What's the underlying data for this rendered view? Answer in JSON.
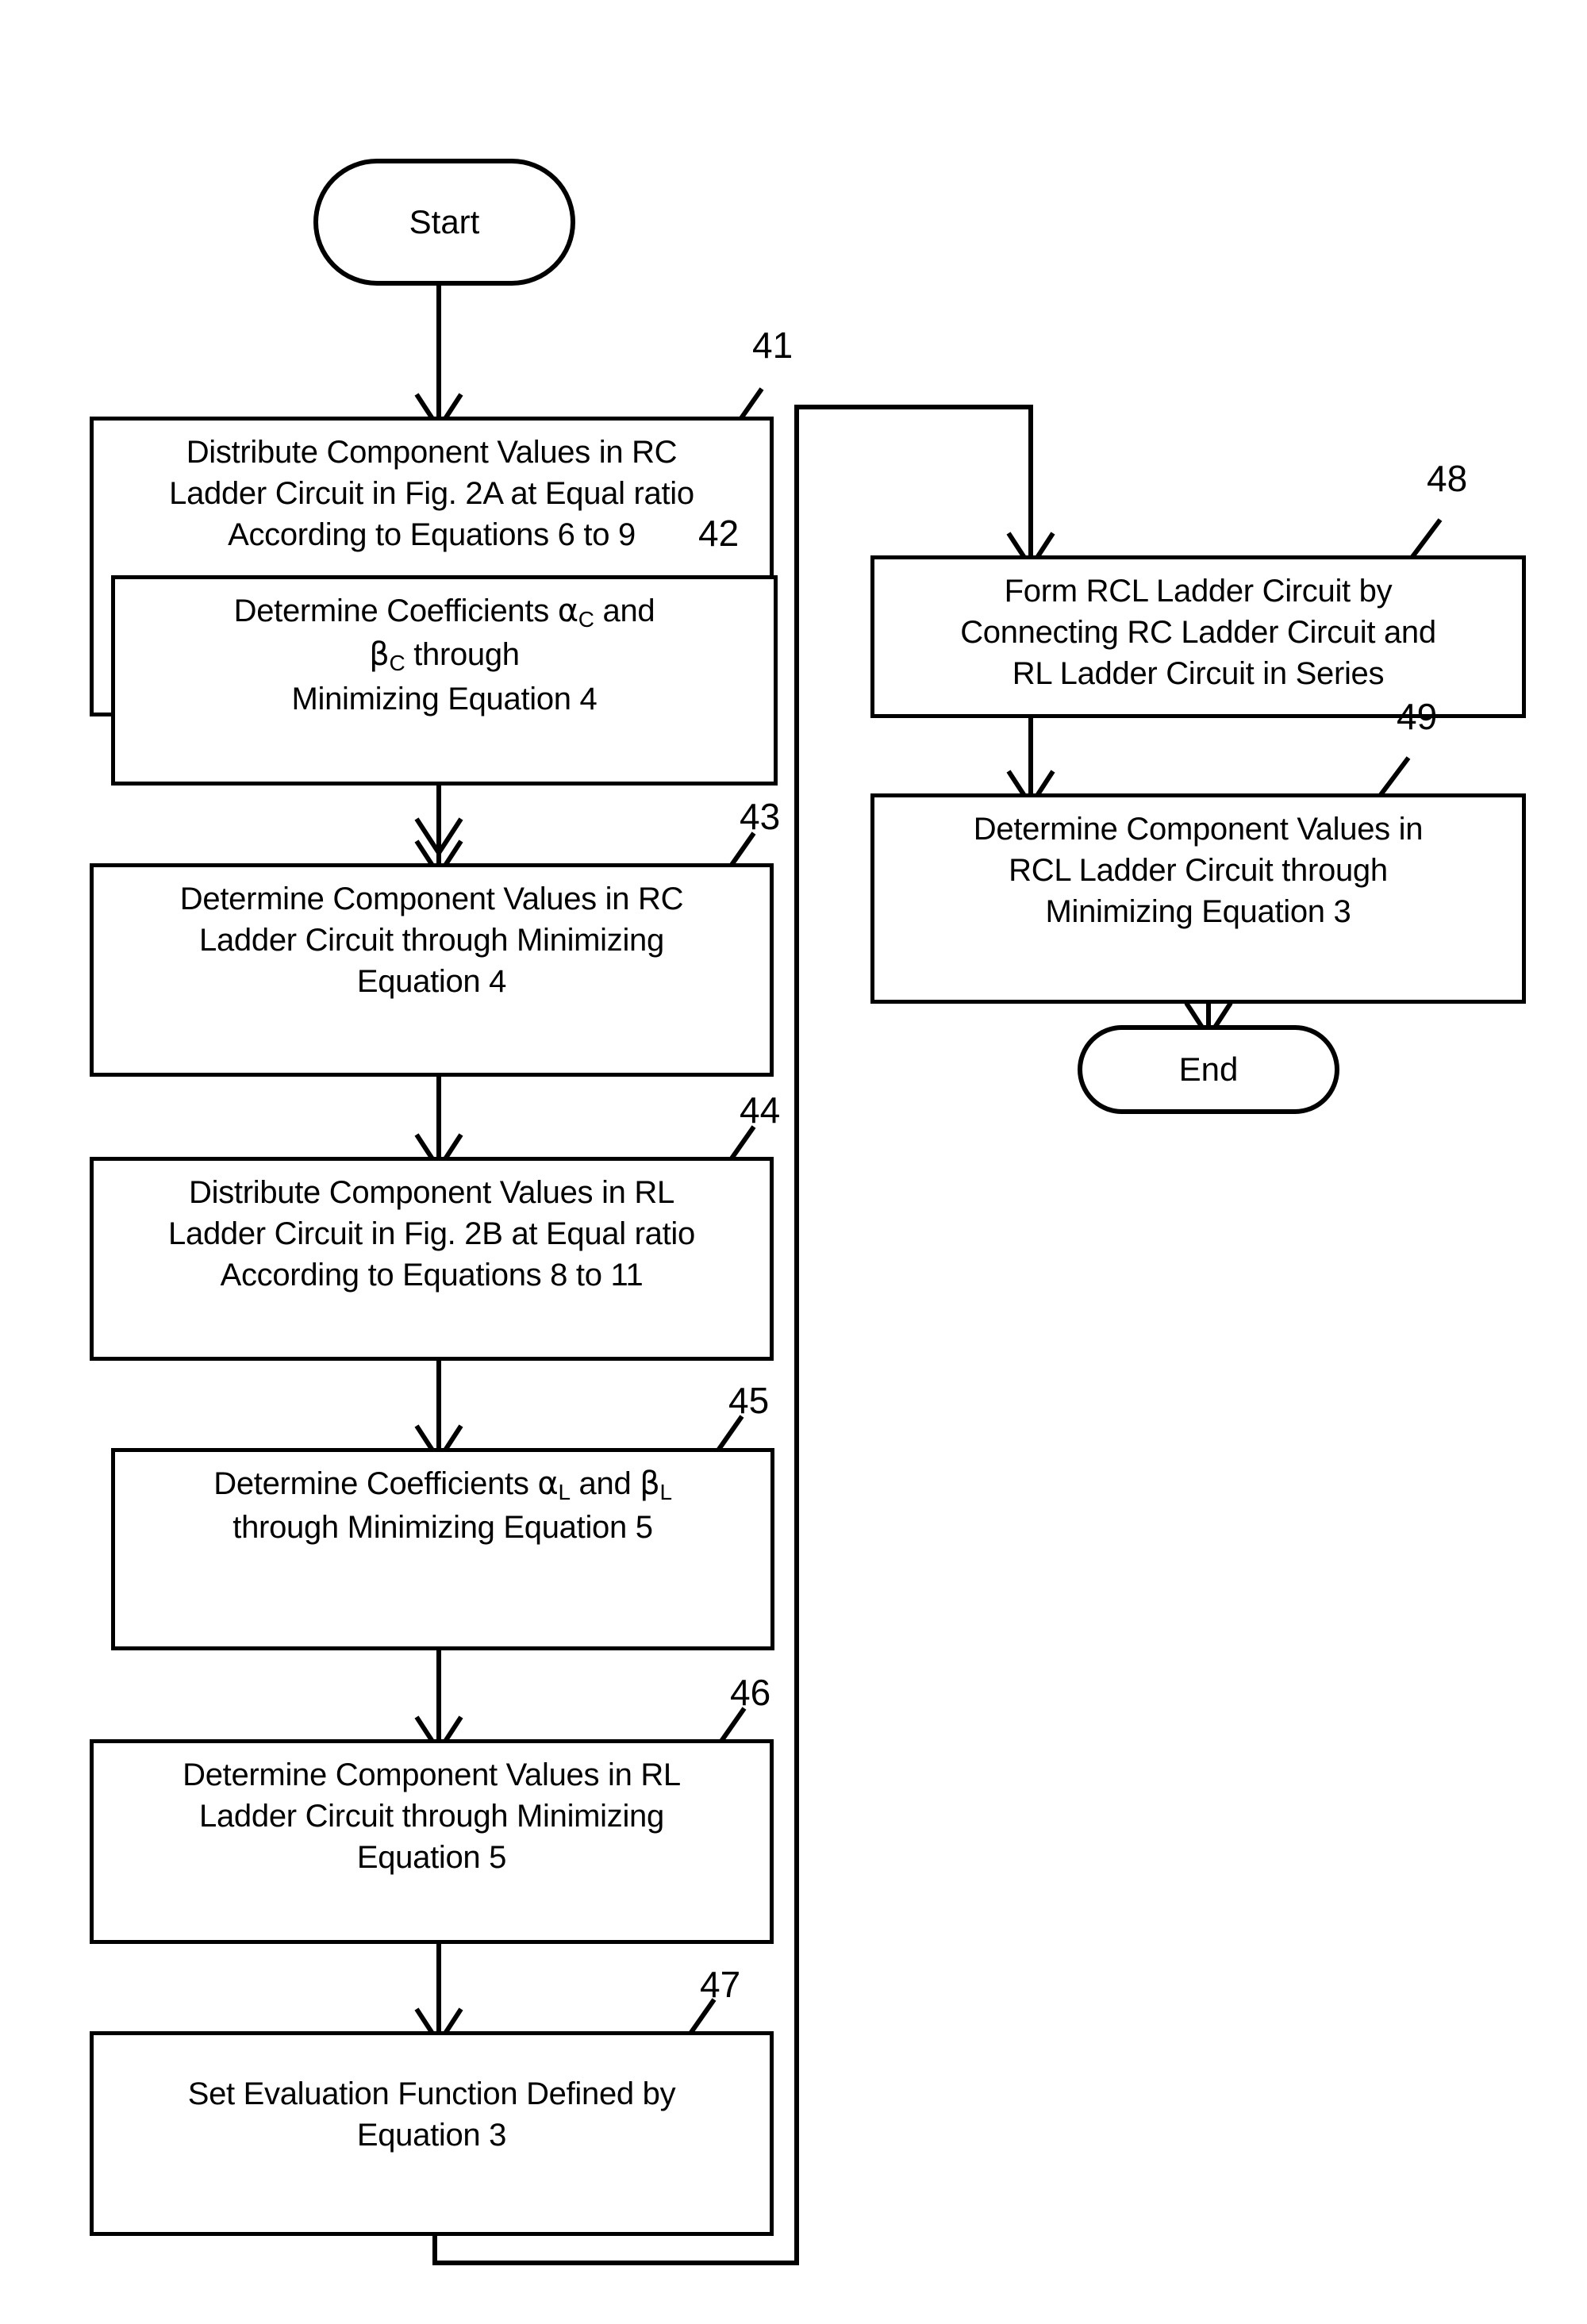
{
  "figure": {
    "type": "flowchart",
    "orientation": "two-column",
    "line_color": "#000000",
    "background_color": "#ffffff"
  },
  "terminals": {
    "start": {
      "label": "Start"
    },
    "end": {
      "label": "End"
    }
  },
  "nodes": [
    {
      "ref": "41",
      "lines": [
        "Distribute Component Values in RC",
        "Ladder Circuit in Fig. 2A at Equal ratio",
        "According to Equations 6 to 9"
      ]
    },
    {
      "ref": "42",
      "lines": [
        "Determine Coefficients αC and",
        "βC through",
        "Minimizing Equation 4"
      ]
    },
    {
      "ref": "43",
      "lines": [
        "Determine Component Values in RC",
        "Ladder Circuit through Minimizing",
        "Equation 4"
      ]
    },
    {
      "ref": "44",
      "lines": [
        "Distribute Component Values in RL",
        "Ladder Circuit in Fig. 2B at Equal ratio",
        "According to Equations 8 to 11"
      ]
    },
    {
      "ref": "45",
      "lines": [
        "Determine Coefficients αL and βL",
        "through Minimizing Equation 5"
      ]
    },
    {
      "ref": "46",
      "lines": [
        "Determine Component Values in RL",
        "Ladder Circuit through Minimizing",
        "Equation 5"
      ]
    },
    {
      "ref": "47",
      "lines": [
        "Set Evaluation Function Defined by",
        "Equation 3"
      ]
    },
    {
      "ref": "48",
      "lines": [
        "Form RCL Ladder Circuit by",
        "Connecting RC Ladder Circuit and",
        "RL Ladder Circuit in Series"
      ]
    },
    {
      "ref": "49",
      "lines": [
        "Determine Component Values in",
        "RCL Ladder Circuit through",
        "Minimizing Equation 3"
      ]
    }
  ],
  "box41": {
    "l1": "Distribute Component Values in RC",
    "l2": "Ladder Circuit in Fig. 2A at Equal ratio",
    "l3": "According to Equations 6 to 9",
    "ref": "41"
  },
  "box42": {
    "l1a": "Determine Coefficients ",
    "l1b": "α",
    "l1c": "C",
    "l1d": " and",
    "l2a": "β",
    "l2b": "C",
    "l2c": " through",
    "l3": "Minimizing Equation 4",
    "ref": "42"
  },
  "box43": {
    "l1": "Determine Component Values in RC",
    "l2": "Ladder Circuit through Minimizing",
    "l3": "Equation 4",
    "ref": "43"
  },
  "box44": {
    "l1": "Distribute Component Values in RL",
    "l2": "Ladder Circuit in Fig. 2B at Equal ratio",
    "l3": "According to Equations 8 to 11",
    "ref": "44"
  },
  "box45": {
    "l1a": "Determine Coefficients ",
    "l1b": "α",
    "l1c": "L",
    "l1d": " and ",
    "l1e": "β",
    "l1f": "L",
    "l2": "through Minimizing Equation 5",
    "ref": "45"
  },
  "box46": {
    "l1": "Determine Component Values in RL",
    "l2": "Ladder Circuit through Minimizing",
    "l3": "Equation 5",
    "ref": "46"
  },
  "box47": {
    "l1": "Set Evaluation Function Defined by",
    "l2": "Equation 3",
    "ref": "47"
  },
  "box48": {
    "l1": "Form RCL Ladder Circuit by",
    "l2": "Connecting RC Ladder Circuit and",
    "l3": "RL Ladder Circuit in Series",
    "ref": "48"
  },
  "box49": {
    "l1": "Determine Component Values in",
    "l2": "RCL Ladder Circuit through",
    "l3": "Minimizing Equation 3",
    "ref": "49"
  }
}
